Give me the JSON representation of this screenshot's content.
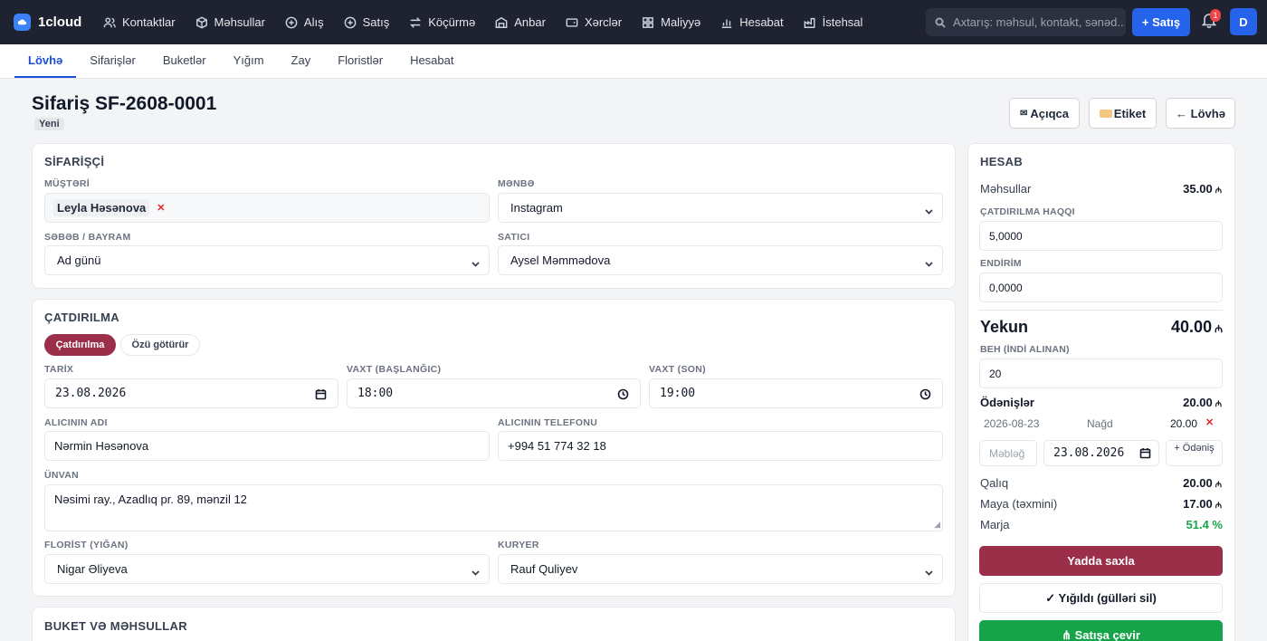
{
  "app": {
    "name": "1cloud",
    "sale_button": "+ Satış",
    "notifications_count": "1",
    "user_initial": "D"
  },
  "nav": [
    {
      "label": "Kontaktlar",
      "icon": "users-icon"
    },
    {
      "label": "Məhsullar",
      "icon": "box-icon"
    },
    {
      "label": "Alış",
      "icon": "plus-circle-icon"
    },
    {
      "label": "Satış",
      "icon": "plus-circle-icon"
    },
    {
      "label": "Köçürmə",
      "icon": "transfer-icon"
    },
    {
      "label": "Anbar",
      "icon": "warehouse-icon"
    },
    {
      "label": "Xərclər",
      "icon": "wallet-icon"
    },
    {
      "label": "Maliyyə",
      "icon": "grid-icon"
    },
    {
      "label": "Hesabat",
      "icon": "bar-chart-icon"
    },
    {
      "label": "İstehsal",
      "icon": "factory-icon"
    }
  ],
  "search": {
    "placeholder": "Axtarış: məhsul, kontakt, sənəd..."
  },
  "subnav": [
    "Lövhə",
    "Sifarişlər",
    "Buketlər",
    "Yığım",
    "Zay",
    "Floristlər",
    "Hesabat"
  ],
  "header": {
    "title": "Sifariş SF-2608-0001",
    "status": "Yeni",
    "btn_open": "Açıqca",
    "btn_label": "Etiket",
    "btn_back": "← Lövhə"
  },
  "orderer": {
    "title": "SİFARİŞÇİ",
    "customer_label": "MÜŞTƏRİ",
    "customer_value": "Leyla Həsənova",
    "source_label": "MƏNBƏ",
    "source_value": "Instagram",
    "reason_label": "SƏBƏB / BAYRAM",
    "reason_value": "Ad günü",
    "seller_label": "SATICI",
    "seller_value": "Aysel Məmmədova"
  },
  "delivery": {
    "title": "ÇATDIRILMA",
    "mode_delivery": "Çatdırılma",
    "mode_pickup": "Özü götürür",
    "date_label": "TARİX",
    "date_value": "23.08.2026",
    "time_start_label": "VAXT (BAŞLANĞIC)",
    "time_start_value": "18:00",
    "time_end_label": "VAXT (SON)",
    "time_end_value": "19:00",
    "recipient_name_label": "ALICININ ADI",
    "recipient_name_value": "Nərmin Həsənova",
    "recipient_phone_label": "ALICININ TELEFONU",
    "recipient_phone_value": "+994 51 774 32 18",
    "address_label": "ÜNVAN",
    "address_value": "Nəsimi ray., Azadlıq pr. 89, mənzil 12",
    "florist_label": "FLORİST (YIĞAN)",
    "florist_value": "Nigar Əliyeva",
    "courier_label": "KURYER",
    "courier_value": "Rauf Quliyev"
  },
  "bouquet": {
    "title": "BUKET VƏ MƏHSULLAR"
  },
  "summary": {
    "title": "HESAB",
    "products_label": "Məhsullar",
    "products_value": "35.00",
    "delivery_fee_label": "ÇATDIRILMA HAQQI",
    "delivery_fee_value": "5,0000",
    "discount_label": "ENDİRİM",
    "discount_value": "0,0000",
    "total_label": "Yekun",
    "total_value": "40.00",
    "prepay_label": "BEH (İNDİ ALINAN)",
    "prepay_value": "20",
    "payments_label": "Ödənişlər",
    "payments_value": "20.00",
    "payment_date": "2026-08-23",
    "payment_method": "Nağd",
    "payment_amount": "20.00",
    "amount_placeholder": "Məbləğ",
    "new_payment_date": "23.08.2026",
    "add_payment": "+ Ödəniş",
    "remaining_label": "Qalıq",
    "remaining_value": "20.00",
    "cost_label": "Maya (təxmini)",
    "cost_value": "17.00",
    "margin_label": "Marja",
    "margin_value": "51.4 %",
    "save_button": "Yadda saxla",
    "assembled_button": "✓ Yığıldı (gülləri sil)",
    "convert_button": "⋔ Satışa çevir"
  },
  "colors": {
    "accent": "#9b2f4a",
    "primary": "#2563eb",
    "success": "#16a34a",
    "topbar": "#1f2230"
  }
}
